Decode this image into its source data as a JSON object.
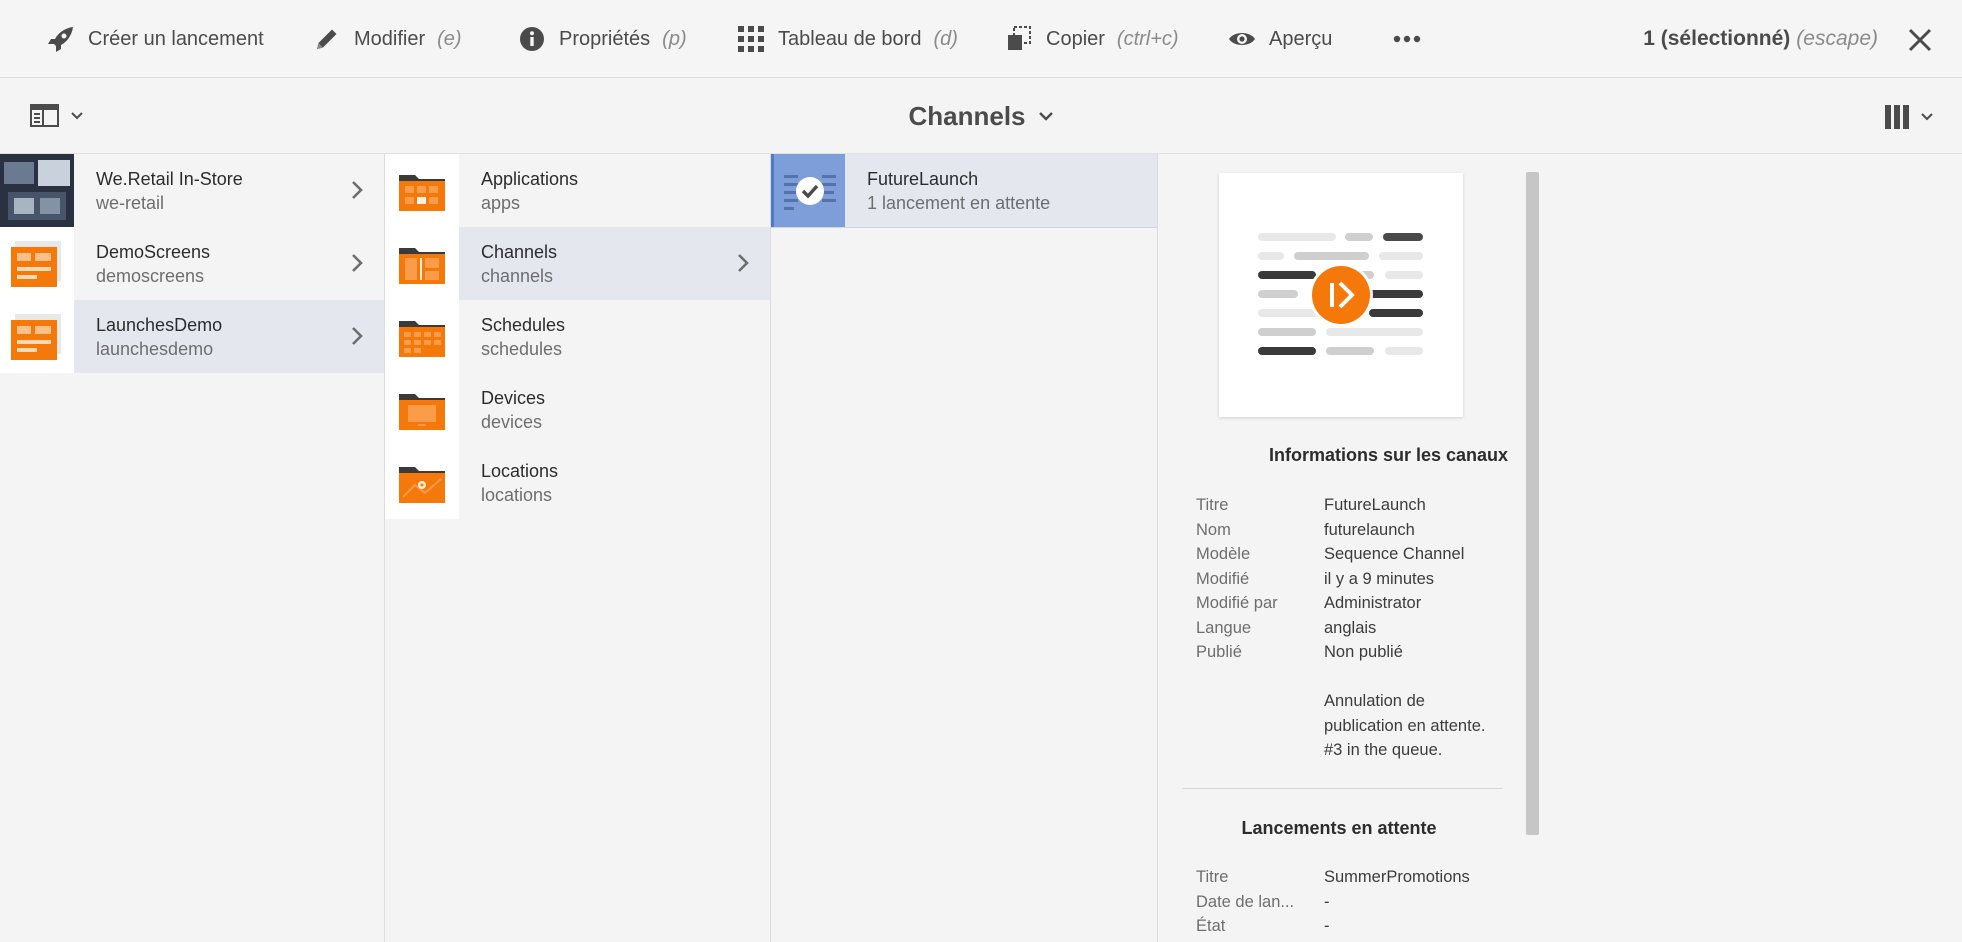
{
  "toolbar": {
    "create_launch": "Créer un lancement",
    "edit": "Modifier",
    "edit_shortcut": "(e)",
    "properties": "Propriétés",
    "properties_shortcut": "(p)",
    "dashboard": "Tableau de bord",
    "dashboard_shortcut": "(d)",
    "copy": "Copier",
    "copy_shortcut": "(ctrl+c)",
    "preview": "Aperçu",
    "selection_count": "1 (sélectionné)",
    "selection_escape": "(escape)"
  },
  "header": {
    "title": "Channels"
  },
  "column1": [
    {
      "title": "We.Retail In-Store",
      "name": "we-retail",
      "thumb": "photo"
    },
    {
      "title": "DemoScreens",
      "name": "demoscreens",
      "thumb": "orange-screen"
    },
    {
      "title": "LaunchesDemo",
      "name": "launchesdemo",
      "thumb": "orange-screen"
    }
  ],
  "column2": [
    {
      "title": "Applications",
      "name": "apps",
      "thumb": "folder-apps"
    },
    {
      "title": "Channels",
      "name": "channels",
      "thumb": "folder-channels"
    },
    {
      "title": "Schedules",
      "name": "schedules",
      "thumb": "folder-schedules"
    },
    {
      "title": "Devices",
      "name": "devices",
      "thumb": "folder-devices"
    },
    {
      "title": "Locations",
      "name": "locations",
      "thumb": "folder-locations"
    }
  ],
  "column3": [
    {
      "title": "FutureLaunch",
      "subtitle": "1 lancement en attente",
      "thumb": "sequence-selected"
    }
  ],
  "details": {
    "heading": "Informations sur les canaux",
    "props": [
      {
        "k": "Titre",
        "v": "FutureLaunch"
      },
      {
        "k": "Nom",
        "v": "futurelaunch"
      },
      {
        "k": "Modèle",
        "v": "Sequence Channel"
      },
      {
        "k": "Modifié",
        "v": "il y a 9 minutes"
      },
      {
        "k": "Modifié par",
        "v": "Administrator"
      },
      {
        "k": "Langue",
        "v": "anglais"
      },
      {
        "k": "Publié",
        "v": "Non publié"
      }
    ],
    "publish_note_1": "Annulation de",
    "publish_note_2": "publication en attente.",
    "publish_note_3": "#3 in the queue.",
    "pending_heading": "Lancements en attente",
    "pending_props": [
      {
        "k": "Titre",
        "v": "SummerPromotions"
      },
      {
        "k": "Date de lan...",
        "v": "-"
      },
      {
        "k": "État",
        "v": "-"
      }
    ]
  },
  "colors": {
    "accent": "#2d69c4",
    "orange": "#f5780a",
    "selection": "#e4e8ee"
  }
}
